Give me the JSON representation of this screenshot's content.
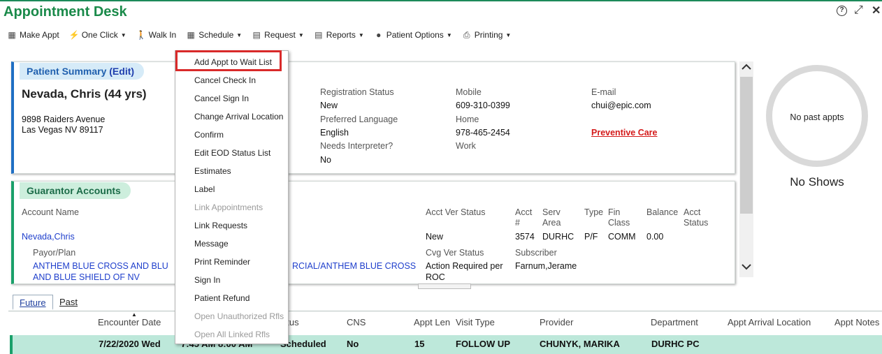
{
  "app": {
    "title": "Appointment Desk",
    "help": "?",
    "expand": "⤢",
    "close": "✕"
  },
  "toolbar": [
    {
      "label": "Make Appt",
      "icon": "▦",
      "icon_name": "calendar-icon",
      "caret": false
    },
    {
      "label": "One Click",
      "icon": "⚡",
      "icon_name": "lightning-icon",
      "caret": true
    },
    {
      "label": "Walk In",
      "icon": "🚶",
      "icon_name": "walking-person-icon",
      "caret": false
    },
    {
      "label": "Schedule",
      "icon": "▦",
      "icon_name": "schedule-calendar-icon",
      "caret": true
    },
    {
      "label": "Request",
      "icon": "▤",
      "icon_name": "request-icon",
      "caret": true
    },
    {
      "label": "Reports",
      "icon": "▤",
      "icon_name": "report-icon",
      "caret": true
    },
    {
      "label": "Patient Options",
      "icon": "●",
      "icon_name": "person-icon",
      "caret": true
    },
    {
      "label": "Printing",
      "icon": "⎙",
      "icon_name": "printer-icon",
      "caret": true
    }
  ],
  "summary": {
    "header": "Patient Summary",
    "edit": "(Edit)",
    "name": "Nevada, Chris (44 yrs)",
    "address1": "9898 Raiders Avenue",
    "address2": "Las Vegas NV 89117",
    "reg_status_label": "Registration Status",
    "reg_status": "New",
    "pref_lang_label": "Preferred Language",
    "pref_lang": "English",
    "interp_label": "Needs Interpreter?",
    "interp": "No",
    "mobile_label": "Mobile",
    "mobile": "609-310-0399",
    "home_label": "Home",
    "home": "978-465-2454",
    "work_label": "Work",
    "email_label": "E-mail",
    "email": "chui@epic.com",
    "preventive": "Preventive Care"
  },
  "guarantor": {
    "header": "Guarantor Accounts",
    "account_name_label": "Account Name",
    "account_name": "Nevada,Chris",
    "payor_label": "Payor/Plan",
    "payor_line1_left": "ANTHEM BLUE CROSS AND BLU",
    "payor_line1_right": "RCIAL/ANTHEM BLUE CROSS",
    "payor_line2": "AND BLUE SHIELD OF NV",
    "acct_ver_label": "Acct Ver Status",
    "acct_ver": "New",
    "acct_num_label1": "Acct",
    "acct_num_label2": "#",
    "acct_num": "3574",
    "serv_area_label1": "Serv",
    "serv_area_label2": "Area",
    "serv_area": "DURHC",
    "type_label": "Type",
    "type": "P/F",
    "fin_class_label1": "Fin",
    "fin_class_label2": "Class",
    "fin_class": "COMM",
    "balance_label": "Balance",
    "balance": "0.00",
    "acct_status_label1": "Acct",
    "acct_status_label2": "Status",
    "cvg_ver_label": "Cvg Ver Status",
    "cvg_ver1": "Action Required per",
    "cvg_ver2": "ROC",
    "subscriber_label": "Subscriber",
    "subscriber": "Farnum,Jerame"
  },
  "side": {
    "no_past": "No past appts",
    "no_shows": "No Shows"
  },
  "tabs": {
    "future": "Future",
    "past": "Past"
  },
  "table": {
    "headers": [
      "Encounter Date",
      "atus",
      "CNS",
      "Appt Len",
      "Visit Type",
      "Provider",
      "Department",
      "Appt Arrival Location",
      "Appt Notes"
    ],
    "row": {
      "date": "7/22/2020 Wed",
      "time": "7:45 AM  8:00 AM",
      "status": "Scheduled",
      "cns": "No",
      "len": "15",
      "visit": "FOLLOW UP",
      "provider": "CHUNYK, MARIKA",
      "dept": "DURHC PC"
    }
  },
  "menu": {
    "items": [
      {
        "label": "Add Appt to Wait List",
        "disabled": false
      },
      {
        "label": "Cancel Check In",
        "disabled": false
      },
      {
        "label": "Cancel Sign In",
        "disabled": false
      },
      {
        "label": "Change Arrival Location",
        "disabled": false
      },
      {
        "label": "Confirm",
        "disabled": false
      },
      {
        "label": "Edit EOD Status List",
        "disabled": false
      },
      {
        "label": "Estimates",
        "disabled": false
      },
      {
        "label": "Label",
        "disabled": false
      },
      {
        "label": "Link Appointments",
        "disabled": true
      },
      {
        "label": "Link Requests",
        "disabled": false
      },
      {
        "label": "Message",
        "disabled": false
      },
      {
        "label": "Print Reminder",
        "disabled": false
      },
      {
        "label": "Sign In",
        "disabled": false
      },
      {
        "label": "Patient Refund",
        "disabled": false
      },
      {
        "label": "Open Unauthorized Rfls",
        "disabled": true
      },
      {
        "label": "Open All Linked Rfls",
        "disabled": true
      }
    ]
  },
  "colors": {
    "brand": "#1a8a4a",
    "highlight": "#d92a2a",
    "row": "#bde8da",
    "summary_accent": "#1f6fc4"
  }
}
